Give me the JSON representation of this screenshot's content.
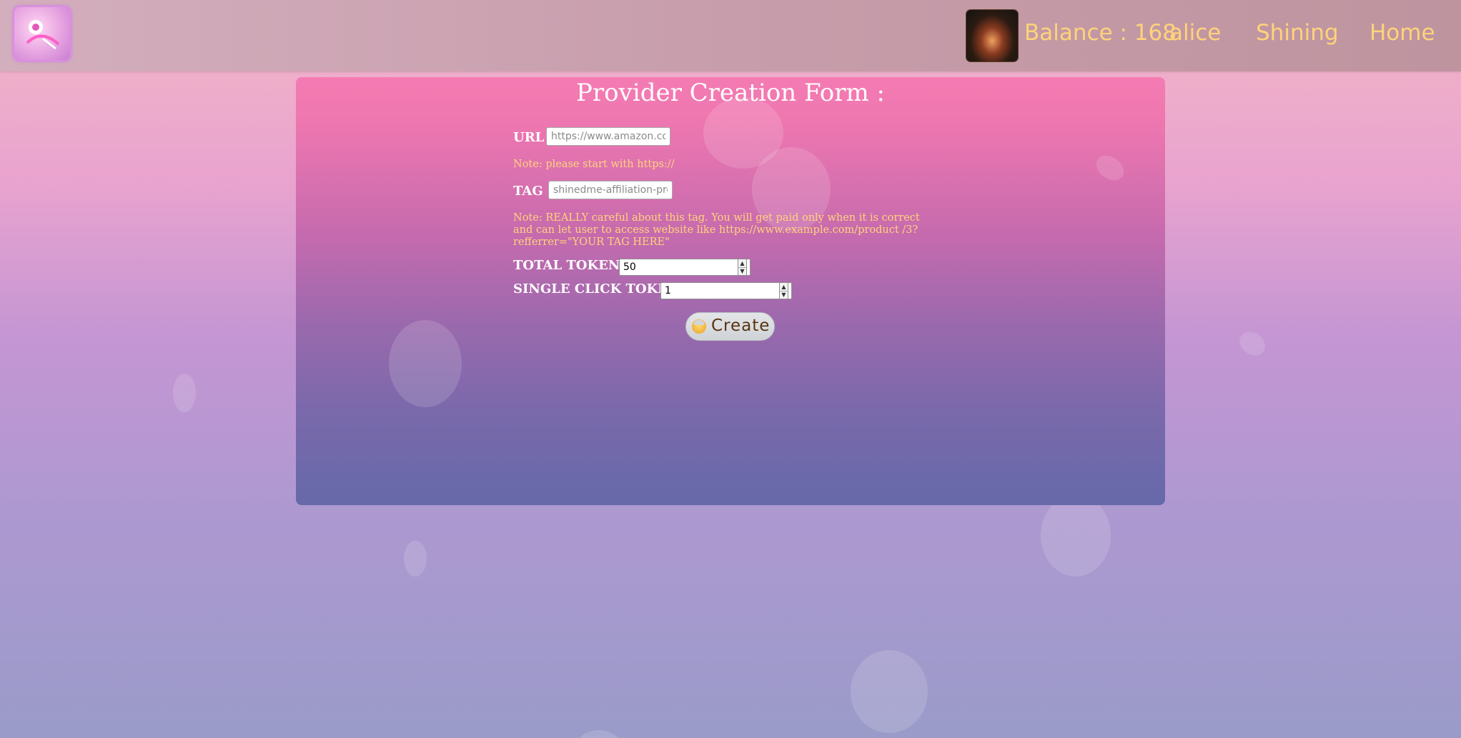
{
  "header": {
    "logo_icon": "brand-logo-icon",
    "avatar_icon": "user-avatar-icon",
    "balance_text": "Balance : 168",
    "username": "alice",
    "nav_shining": "Shining",
    "nav_home": "Home"
  },
  "form": {
    "title": "Provider Creation Form :",
    "url_label": "URL :",
    "url_placeholder": "https://www.amazon.com/",
    "url_value": "",
    "url_note": "Note: please start with https://",
    "tag_label": "TAG :",
    "tag_placeholder": "shinedme-affiliation-program",
    "tag_value": "",
    "tag_note": "Note: REALLY careful about this tag. You will get paid only when it is correct and can let user to access website like https://www.example.com/product /3?refferrer=\"YOUR TAG HERE\"",
    "total_tokens_label": "TOTAL TOKENS :",
    "total_tokens_value": "50",
    "single_click_label": "SINGLE CLICK TOKEN :",
    "single_click_value": "1",
    "create_button_label": "Create",
    "create_button_icon": "angel-icon"
  },
  "colors": {
    "accent_text": "#ffd37a",
    "panel_top": "#f47bb2",
    "panel_bottom": "#6669a9",
    "button_text": "#5a3310"
  }
}
